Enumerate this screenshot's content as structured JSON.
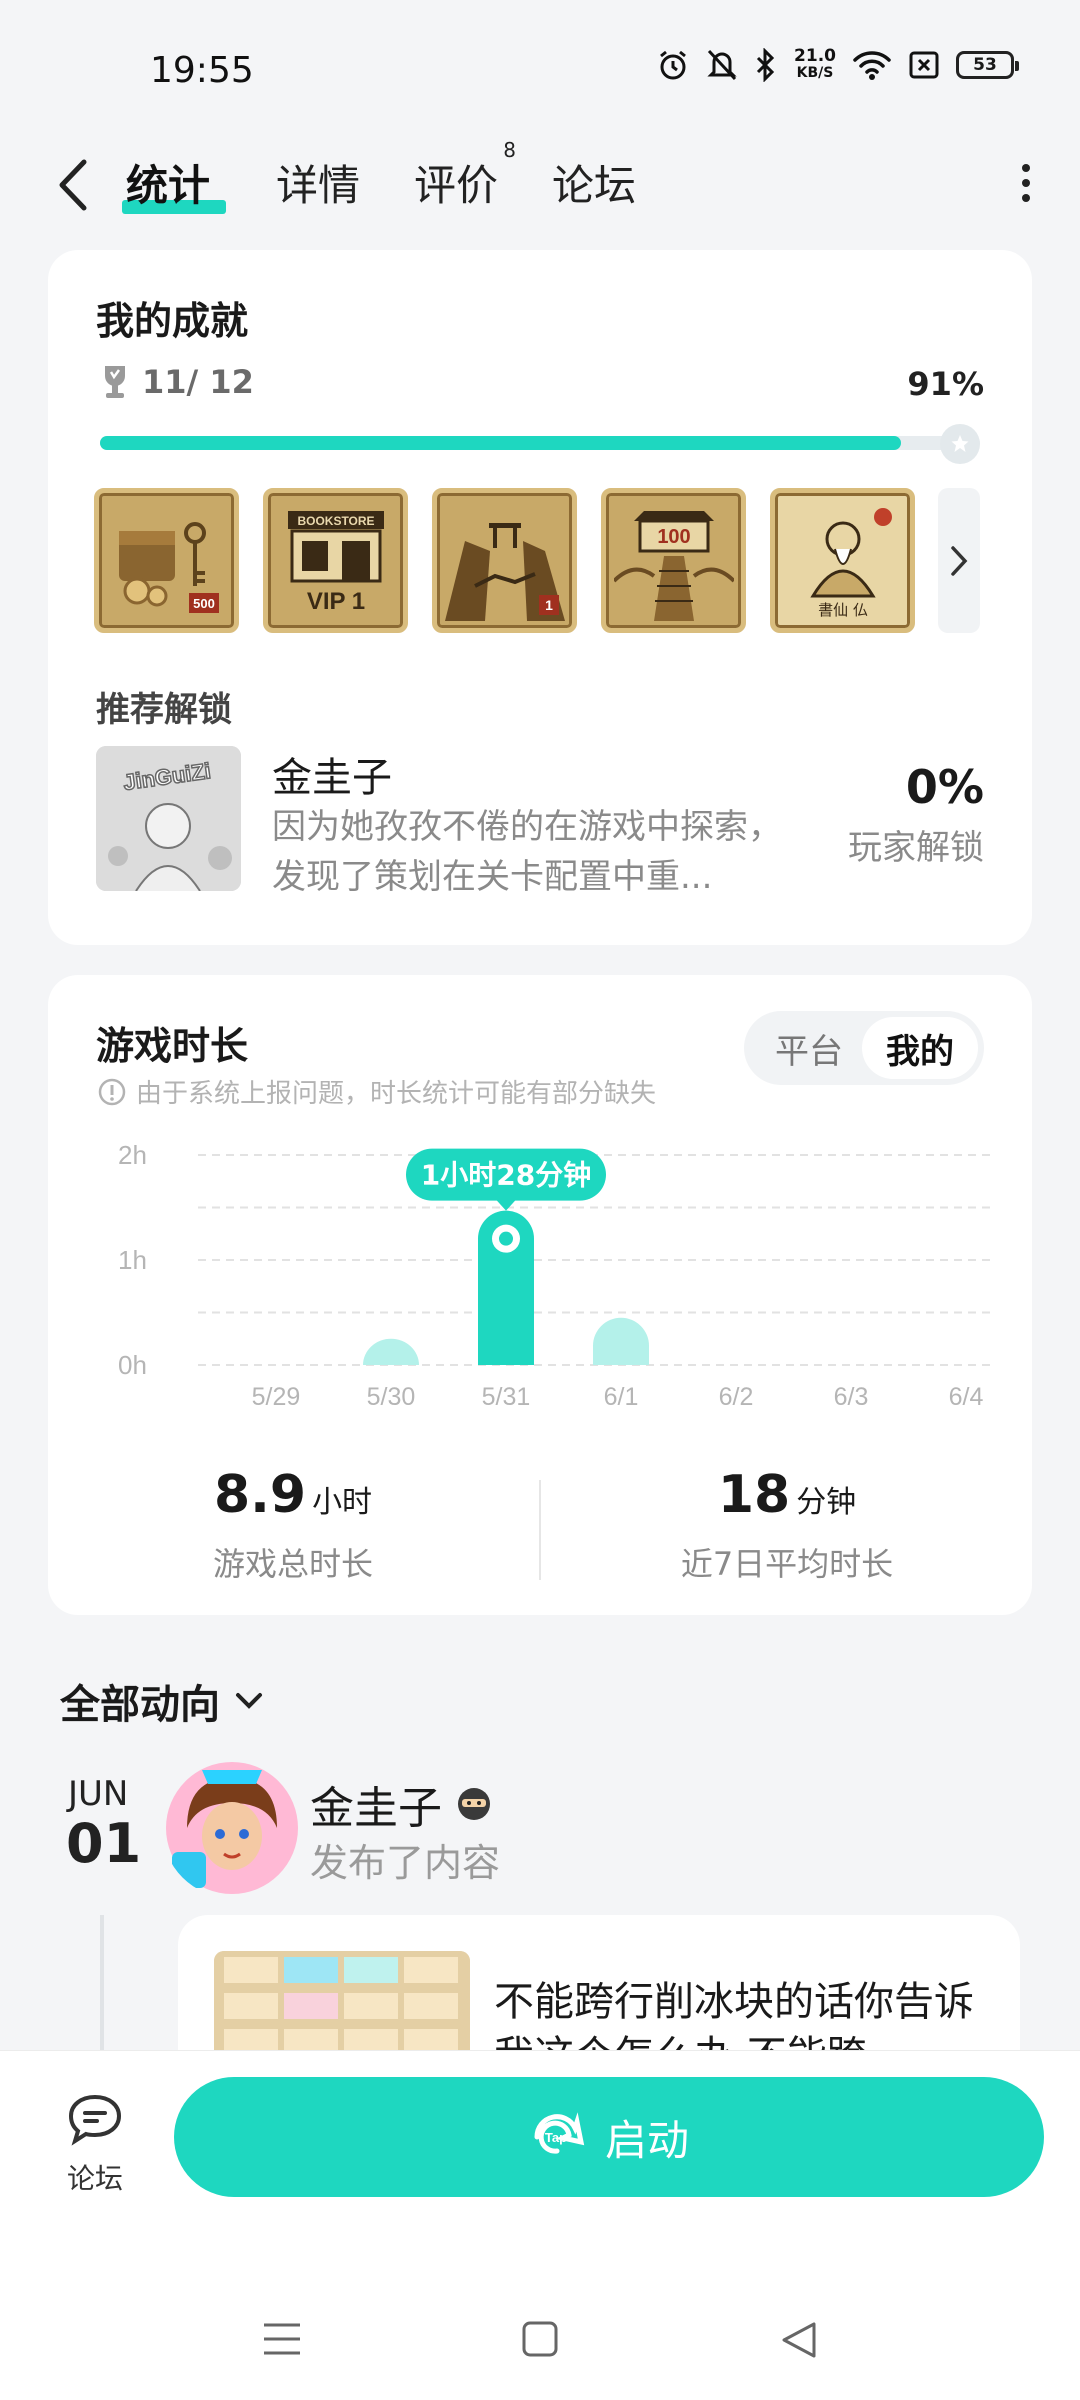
{
  "status_bar": {
    "time": "19:55",
    "net_speed_value": "21.0",
    "net_speed_unit": "KB/S",
    "battery": "53",
    "icons": [
      "alarm-icon",
      "mute-bell-icon",
      "bluetooth-icon",
      "wifi-icon",
      "sim-blocked-icon"
    ]
  },
  "nav": {
    "tabs": [
      {
        "label": "统计",
        "active": true
      },
      {
        "label": "详情"
      },
      {
        "label": "评价",
        "badge": "8"
      },
      {
        "label": "论坛"
      }
    ]
  },
  "achievements": {
    "title": "我的成就",
    "count": "11/ 12",
    "percent": "91%",
    "progress": 0.91,
    "badges": [
      "treasure-keys-500",
      "bookstore-vip-1",
      "cliff-gate-1",
      "stairs-100",
      "sage-calligraphy"
    ],
    "badge_texts": {
      "b1": "500",
      "b2_top": "BOOKSTORE",
      "b2_main": "VIP 1",
      "b3": "1",
      "b4": "100",
      "b5": "書仙 仏"
    },
    "recommend_label": "推荐解锁",
    "recommend": {
      "name": "金圭子",
      "description": "因为她孜孜不倦的在游戏中探索，发现了策划在关卡配置中重...",
      "percent": "0%",
      "percent_label": "玩家解锁",
      "thumb_text": "JinGuiZi"
    }
  },
  "playtime": {
    "title": "游戏时长",
    "notice": "由于系统上报问题，时长统计可能有部分缺失",
    "toggle": {
      "platform": "平台",
      "mine": "我的"
    },
    "total_value": "8.9",
    "total_unit": "小时",
    "total_label": "游戏总时长",
    "avg_value": "18",
    "avg_unit": "分钟",
    "avg_label": "近7日平均时长"
  },
  "chart_data": {
    "type": "bar",
    "categories": [
      "5/29",
      "5/30",
      "5/31",
      "6/1",
      "6/2",
      "6/3",
      "6/4"
    ],
    "values": [
      0,
      0.25,
      1.47,
      0.45,
      0,
      0,
      0
    ],
    "y_ticks": [
      "2h",
      "1h",
      "0h"
    ],
    "ylim": [
      0,
      2
    ],
    "highlight_index": 2,
    "tooltip": "1小时28分钟",
    "grid": true
  },
  "feed": {
    "title": "全部动向",
    "month": "JUN",
    "day": "01",
    "author": "金圭子",
    "action": "发布了内容",
    "post_text": "不能跨行削冰块的话你告诉我这个怎么办 不能跨"
  },
  "bottom": {
    "forum_label": "论坛",
    "launch_label": "启动",
    "launch_logo": "Tap"
  },
  "colors": {
    "accent": "#1ed7c0",
    "accent_light": "#b4f1ea",
    "badge_gold": "#c8a968"
  }
}
